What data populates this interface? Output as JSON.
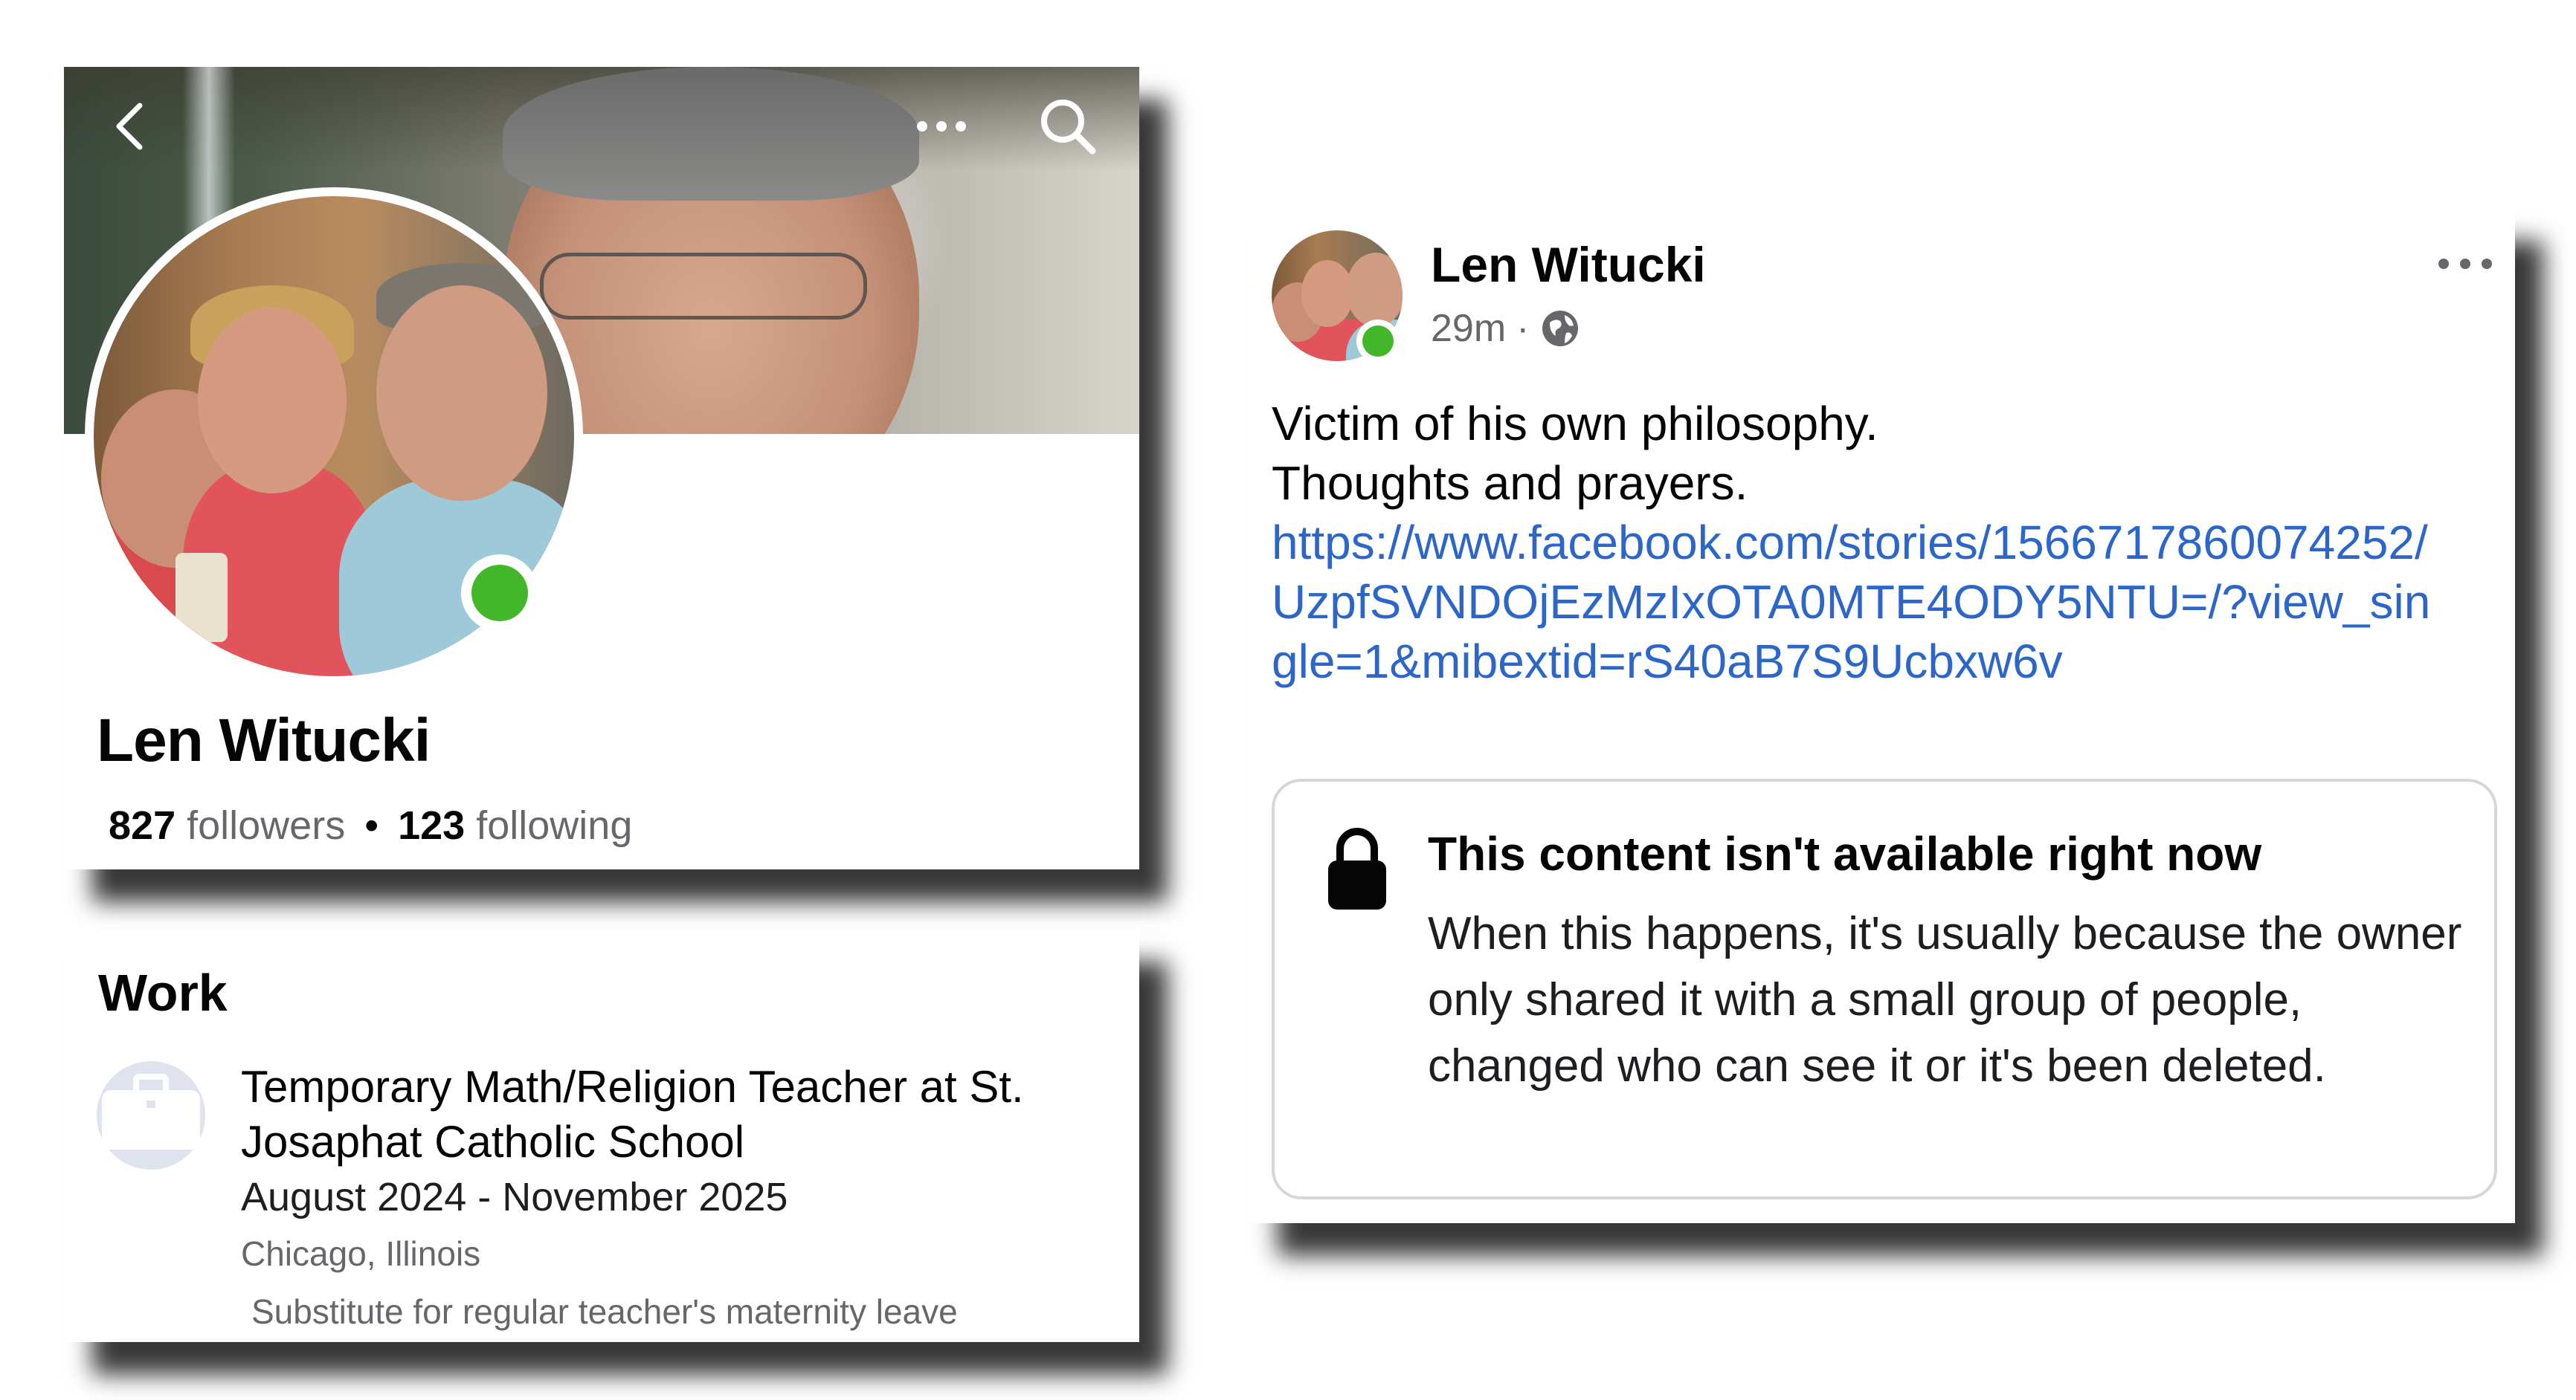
{
  "profile": {
    "name": "Len Witucki",
    "followers_count": "827",
    "followers_label": "followers",
    "separator": "•",
    "following_count": "123",
    "following_label": "following",
    "icons": [
      "back-chevron-icon",
      "more-dots-icon",
      "search-icon"
    ],
    "online_color": "#42b72a"
  },
  "work": {
    "heading": "Work",
    "title": "Temporary Math/Religion Teacher at St. Josaphat Catholic School",
    "dates": "August 2024 - November 2025",
    "location": "Chicago, Illinois",
    "note": "Substitute for regular teacher's maternity leave",
    "icon": "briefcase-icon"
  },
  "post": {
    "author": "Len Witucki",
    "time": "29m",
    "meta_separator": "·",
    "audience_icon": "globe-icon",
    "text_line1": "Victim of his own philosophy.",
    "text_line2": "Thoughts and prayers.",
    "link": "https://www.facebook.com/stories/1566717860074252/UzpfSVNDOjEzMzIxOTA0MTE4ODY5NTU=/?view_single=1&mibextid=rS40aB7S9Ucbxw6v",
    "link_color": "#2d66c9",
    "notice": {
      "icon": "lock-icon",
      "title": "This content isn't available right now",
      "body": "When this happens, it's usually because the owner only shared it with a small group of people, changed who can see it or it's been deleted."
    }
  }
}
